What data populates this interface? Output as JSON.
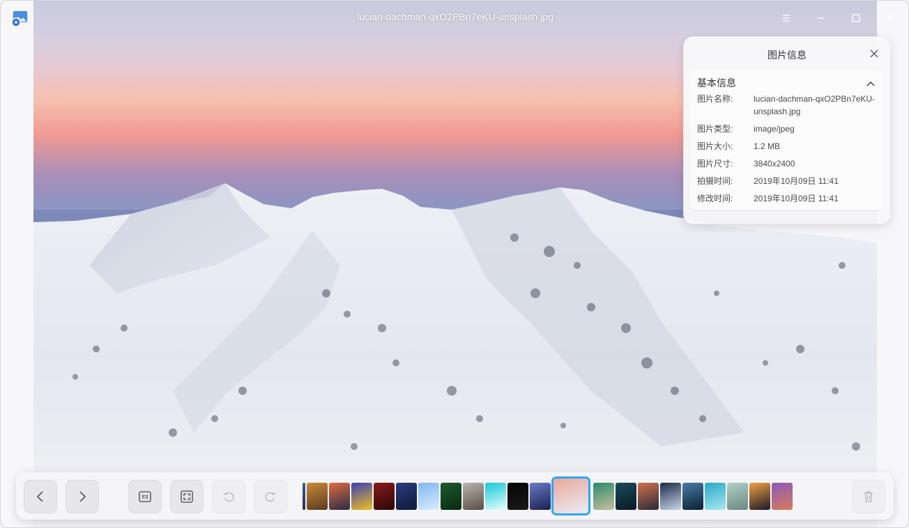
{
  "window": {
    "title": "lucian-dachman-qxO2PBn7eKU-unsplash.jpg"
  },
  "titlebar": {
    "menu_icon": "menu-icon",
    "minimize_icon": "minimize-icon",
    "maximize_icon": "maximize-icon",
    "close_icon": "close-icon"
  },
  "info_panel": {
    "title": "图片信息",
    "section_title": "基本信息",
    "rows": [
      {
        "key": "图片名称:",
        "value": "lucian-dachman-qxO2PBn7eKU-unsplash.jpg"
      },
      {
        "key": "图片类型:",
        "value": "image/jpeg"
      },
      {
        "key": "图片大小:",
        "value": "1.2 MB"
      },
      {
        "key": "图片尺寸:",
        "value": "3840x2400"
      },
      {
        "key": "拍摄时间:",
        "value": "2019年10月09日 11:41"
      },
      {
        "key": "修改时间:",
        "value": "2019年10月09日 11:41"
      }
    ]
  },
  "toolbar": {
    "buttons": [
      "previous-icon",
      "next-icon",
      "original-size-icon",
      "fit-window-icon",
      "rotate-left-icon",
      "rotate-right-icon",
      "delete-icon"
    ],
    "thumbnails": [
      {
        "colors": [
          "#3d5a9a",
          "#1f2f63"
        ]
      },
      {
        "colors": [
          "#c98a3a",
          "#5a3a1f"
        ]
      },
      {
        "colors": [
          "#e06b3c",
          "#2a2a4a"
        ]
      },
      {
        "colors": [
          "#3a3fb8",
          "#f0c020"
        ]
      },
      {
        "colors": [
          "#8a1a1a",
          "#2a0808"
        ]
      },
      {
        "colors": [
          "#2a3b7a",
          "#0f1a3a"
        ]
      },
      {
        "colors": [
          "#7fb8f0",
          "#d8ecff"
        ]
      },
      {
        "colors": [
          "#1c5a2c",
          "#0a2a12"
        ]
      },
      {
        "colors": [
          "#b9b5b0",
          "#5a4e44"
        ]
      },
      {
        "colors": [
          "#14c8d6",
          "#e8ffff"
        ]
      },
      {
        "colors": [
          "#050505",
          "#1a1a1a"
        ]
      },
      {
        "colors": [
          "#6a7ac8",
          "#1a2050"
        ]
      },
      {
        "colors": [
          "#e9a79b",
          "#eaeef6"
        ]
      },
      {
        "colors": [
          "#2a8a6a",
          "#c8c0a0"
        ]
      },
      {
        "colors": [
          "#1a4a5a",
          "#0a1a22"
        ]
      },
      {
        "colors": [
          "#d0704a",
          "#2a2a3a"
        ]
      },
      {
        "colors": [
          "#1a2a4a",
          "#c8d4e8"
        ]
      },
      {
        "colors": [
          "#4a7aa8",
          "#0a2030"
        ]
      },
      {
        "colors": [
          "#2aa8c8",
          "#a8e8f0"
        ]
      },
      {
        "colors": [
          "#b0d0c8",
          "#6a8a80"
        ]
      },
      {
        "colors": [
          "#f0a040",
          "#1a1a2a"
        ]
      },
      {
        "colors": [
          "#8a5ab8",
          "#d87a5a"
        ]
      }
    ],
    "active_index": 12
  }
}
